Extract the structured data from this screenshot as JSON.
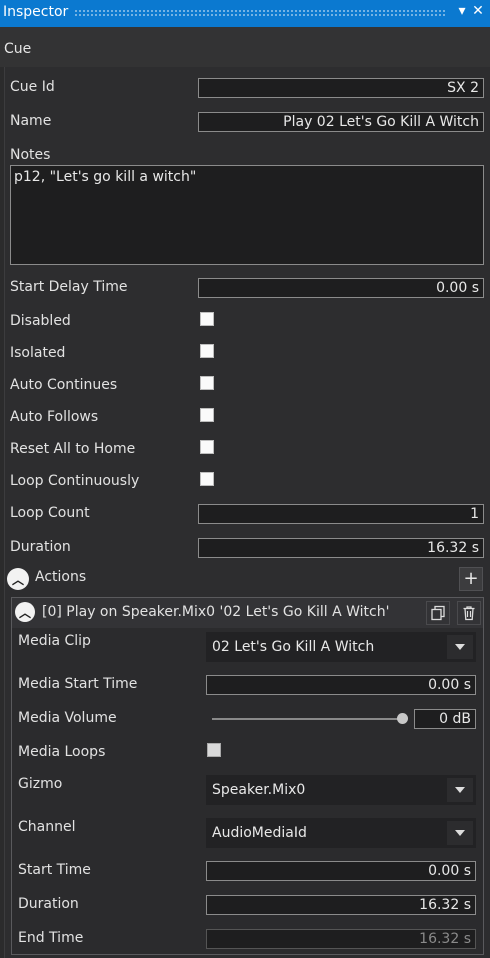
{
  "window": {
    "title": "Inspector"
  },
  "section": {
    "label": "Cue"
  },
  "cue": {
    "cue_id_label": "Cue Id",
    "cue_id": "SX 2",
    "name_label": "Name",
    "name": "Play 02 Let's Go Kill A Witch",
    "notes_label": "Notes",
    "notes": "p12, \"Let's go kill a witch\"",
    "start_delay_label": "Start Delay Time",
    "start_delay": "0.00 s",
    "disabled_label": "Disabled",
    "isolated_label": "Isolated",
    "auto_continues_label": "Auto Continues",
    "auto_follows_label": "Auto Follows",
    "reset_all_label": "Reset All to Home",
    "loop_cont_label": "Loop Continuously",
    "loop_count_label": "Loop Count",
    "loop_count": "1",
    "duration_label": "Duration",
    "duration": "16.32 s"
  },
  "actions": {
    "label": "Actions",
    "items": [
      {
        "title": "[0] Play on Speaker.Mix0 '02 Let's Go Kill A Witch'",
        "media_clip_label": "Media Clip",
        "media_clip": "02 Let's Go Kill A Witch",
        "media_start_label": "Media Start Time",
        "media_start": "0.00 s",
        "media_volume_label": "Media Volume",
        "media_volume": "0 dB",
        "media_volume_level": 1.0,
        "media_loops_label": "Media Loops",
        "gizmo_label": "Gizmo",
        "gizmo": "Speaker.Mix0",
        "channel_label": "Channel",
        "channel": "AudioMediaId",
        "start_time_label": "Start Time",
        "start_time": "0.00 s",
        "duration_label": "Duration",
        "duration": "16.32 s",
        "end_time_label": "End Time",
        "end_time": "16.32 s"
      }
    ]
  },
  "colors": {
    "title_bar": "#0b79d0",
    "background": "#2b2b2c",
    "field_bg": "#1e1e1f"
  }
}
